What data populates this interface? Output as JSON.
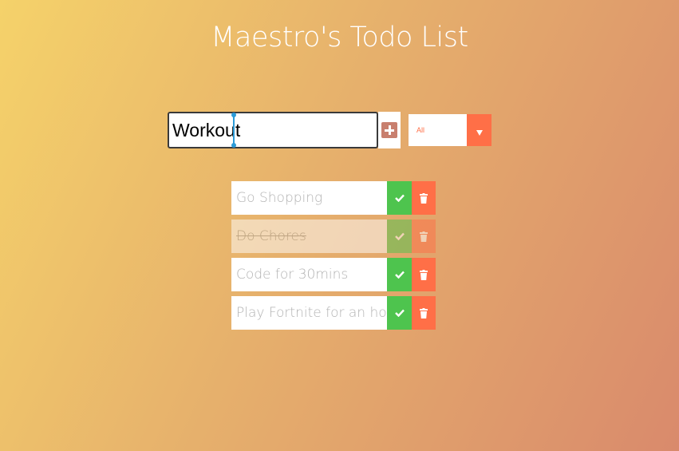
{
  "header": {
    "title": "Maestro's Todo List"
  },
  "form": {
    "input_value": "Workout",
    "add_icon": "plus-square-icon"
  },
  "filter": {
    "selected": "All",
    "arrow_icon": "caret-down-icon"
  },
  "todos": [
    {
      "text": "Go Shopping",
      "completed": false
    },
    {
      "text": "Do Chores",
      "completed": true
    },
    {
      "text": "Code for 30mins",
      "completed": false
    },
    {
      "text": "Play Fortnite for an hour",
      "completed": false
    }
  ],
  "icons": {
    "check": "check-icon",
    "trash": "trash-icon"
  },
  "colors": {
    "accent": "#ff6f47",
    "check": "#4ec44e",
    "add_icon": "#c87f6e",
    "gradient_start": "#f5d26a",
    "gradient_end": "#d98a6c"
  }
}
